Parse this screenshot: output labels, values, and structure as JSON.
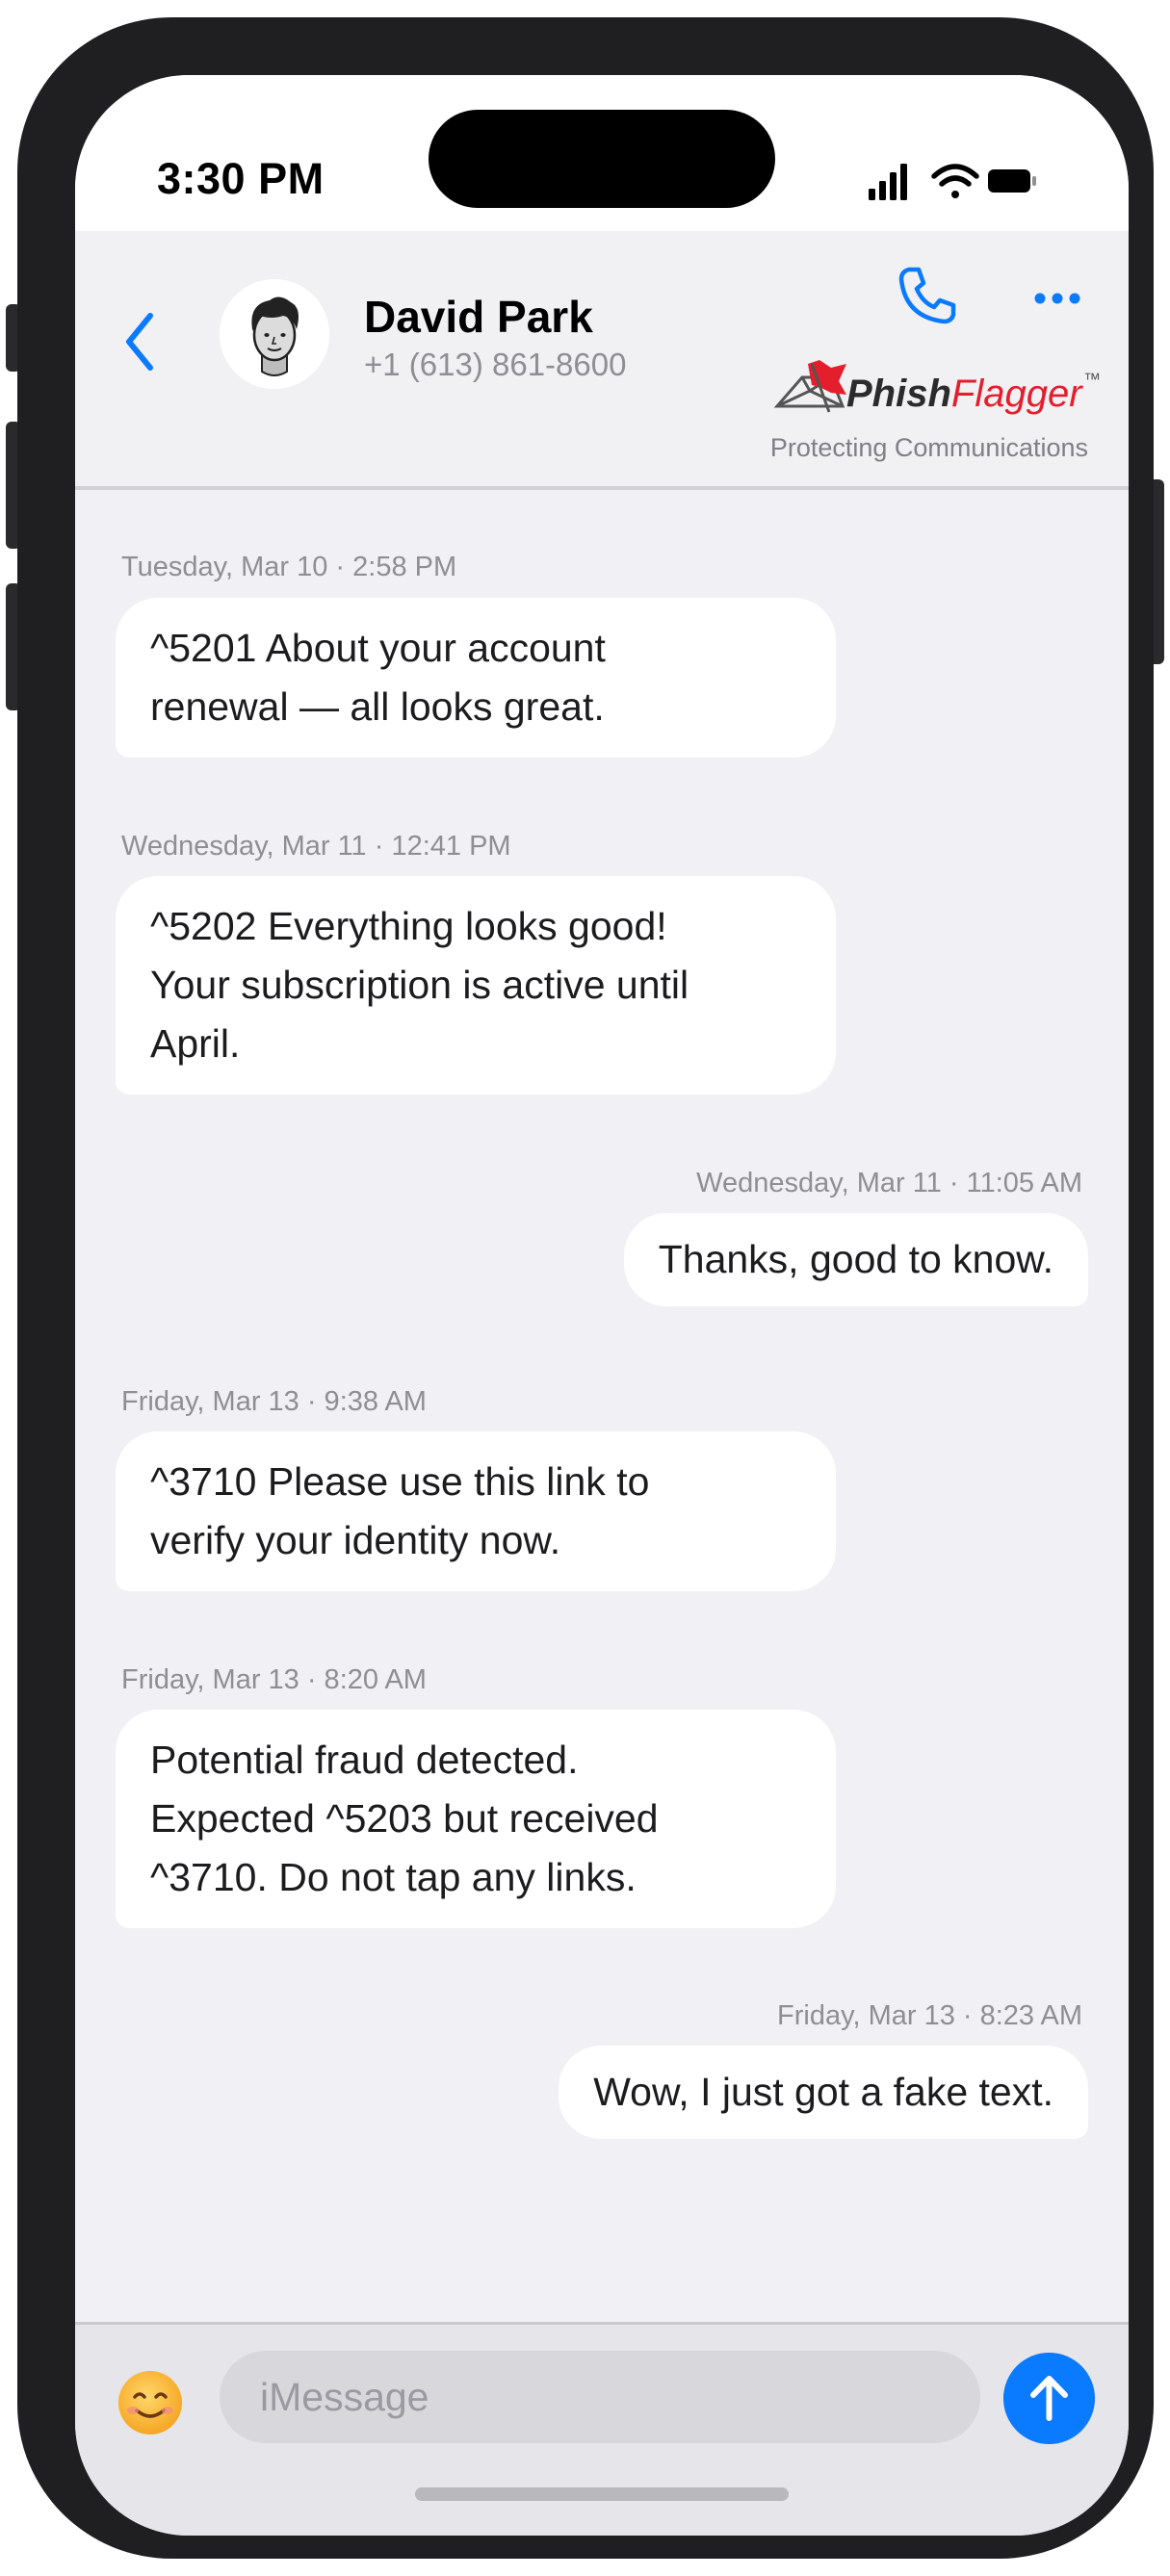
{
  "status_bar": {
    "time": "3:30 PM"
  },
  "header": {
    "contact_name": "David Park",
    "contact_phone": "+1 (613) 861-8600",
    "brand": {
      "name_part1": "Phish",
      "name_part2": "Flagger",
      "trademark": "™",
      "tagline": "Protecting Communications"
    },
    "icons": {
      "back": "chevron-left-icon",
      "call": "phone-icon",
      "more": "ellipsis-icon"
    }
  },
  "colors": {
    "accent": "#0a7aff",
    "brand_red": "#e41e2c",
    "bubble": "#ffffff",
    "background": "#f1f1f5"
  },
  "messages": [
    {
      "direction": "incoming",
      "timestamp": "Tuesday, Mar 10 · 2:58 PM",
      "lines": [
        "^5201 About your account",
        "renewal — all looks great."
      ]
    },
    {
      "direction": "incoming",
      "timestamp": "Wednesday, Mar 11 · 12:41 PM",
      "lines": [
        "^5202 Everything looks good!",
        "Your subscription is active until",
        "April."
      ]
    },
    {
      "direction": "outgoing",
      "timestamp": "Wednesday, Mar 11 · 11:05 AM",
      "lines": [
        "Thanks, good to know."
      ]
    },
    {
      "direction": "incoming",
      "timestamp": "Friday, Mar 13 · 9:38 AM",
      "lines": [
        "^3710 Please use this link to",
        "verify your identity now."
      ]
    },
    {
      "direction": "incoming",
      "timestamp": "Friday, Mar 13 · 8:20 AM",
      "lines": [
        "Potential fraud detected.",
        "Expected ^5203 but received",
        "^3710. Do not tap any links."
      ]
    },
    {
      "direction": "outgoing",
      "timestamp": "Friday, Mar 13 · 8:23 AM",
      "lines": [
        "Wow, I just got a fake text."
      ]
    }
  ],
  "composer": {
    "placeholder": "iMessage",
    "emoji": "😊",
    "send_icon": "arrow-up-icon"
  }
}
